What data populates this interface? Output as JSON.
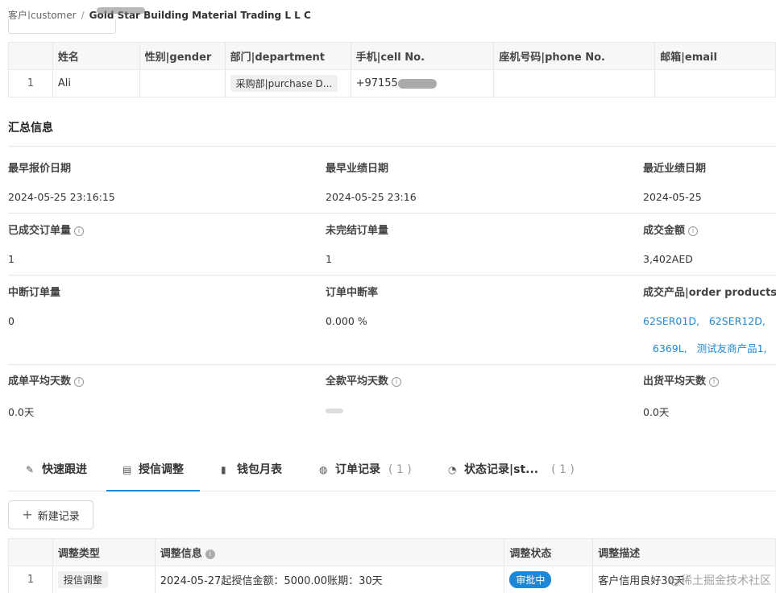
{
  "breadcrumb": {
    "parent": "客户|customer",
    "separator": "/",
    "current": "Gold Star Building Material Trading L L C"
  },
  "contacts": {
    "columns": [
      "",
      "姓名",
      "性别|gender",
      "部门|department",
      "手机|cell No.",
      "座机号码|phone No.",
      "邮箱|email"
    ],
    "rows": [
      {
        "index": "1",
        "name": "Ali",
        "gender": "",
        "department": "采购部|purchase D...",
        "cell": "+97155",
        "phone": "",
        "email": ""
      }
    ]
  },
  "summary": {
    "title": "汇总信息",
    "stats": [
      {
        "label": "最早报价日期",
        "value": "2024-05-25 23:16:15"
      },
      {
        "label": "最早业绩日期",
        "value": "2024-05-25 23:16"
      },
      {
        "label": "最近业绩日期",
        "value": "2024-05-25"
      },
      {
        "label": "已成交订单量",
        "value": "1"
      },
      {
        "label": "未完结订单量",
        "value": "1"
      },
      {
        "label": "成交金额",
        "value": "3,402AED"
      },
      {
        "label": "中断订单量",
        "value": "0"
      },
      {
        "label": "订单中断率",
        "value": "0.000 %"
      },
      {
        "label": "成交产品|order products",
        "value": ""
      },
      {
        "label": "成单平均天数",
        "value": "0.0天"
      },
      {
        "label": "全款平均天数",
        "value": ""
      },
      {
        "label": "出货平均天数",
        "value": "0.0天"
      }
    ],
    "products": [
      "62SER01D,",
      "62SER12D,",
      "6369L,",
      "测试友商产品1,"
    ]
  },
  "tabs": [
    {
      "label": "快速跟进",
      "count": ""
    },
    {
      "label": "授信调整",
      "count": ""
    },
    {
      "label": "钱包月表",
      "count": ""
    },
    {
      "label": "订单记录",
      "count": "( 1 )"
    },
    {
      "label": "状态记录|st...",
      "count": "( 1 )"
    }
  ],
  "new_record_label": "新建记录",
  "credit": {
    "columns": [
      "",
      "调整类型",
      "调整信息",
      "调整状态",
      "调整描述"
    ],
    "rows": [
      {
        "index": "1",
        "type": "授信调整",
        "info": "2024-05-27起授信金额：5000.00账期：30天",
        "status": "审批中",
        "desc": "客户信用良好30天"
      }
    ]
  },
  "watermark": "@稀土掘金技术社区",
  "colors": {
    "accent": "#1e88d6",
    "border": "#e8e8e8",
    "header_bg": "#f7f7f7"
  }
}
